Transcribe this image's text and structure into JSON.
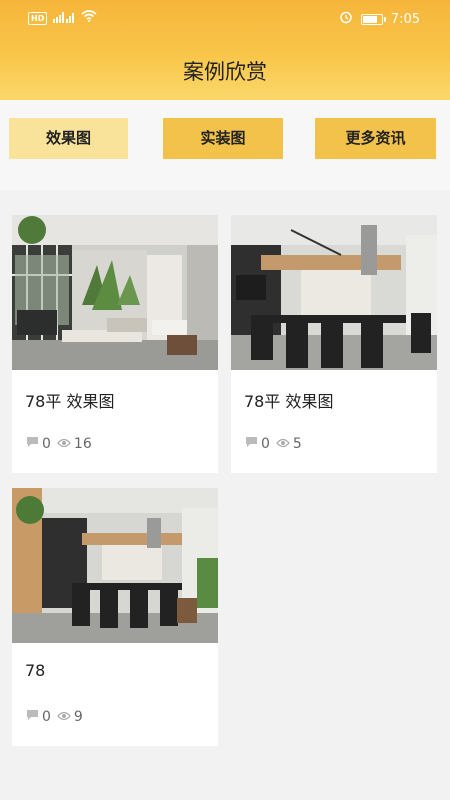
{
  "status_bar": {
    "network": "HD",
    "signal": "4G",
    "time": "7:05"
  },
  "header": {
    "title": "案例欣赏"
  },
  "tabs": [
    {
      "label": "效果图",
      "selected": true
    },
    {
      "label": "实装图",
      "selected": false
    },
    {
      "label": "更多资讯",
      "selected": false
    }
  ],
  "cases": [
    {
      "title": "78平 效果图",
      "comments": "0",
      "views": "16",
      "image": "living-room-photo"
    },
    {
      "title": "78平 效果图",
      "comments": "0",
      "views": "5",
      "image": "dining-kitchen-photo"
    },
    {
      "title": "78",
      "comments": "0",
      "views": "9",
      "image": "dining-kitchen-photo"
    }
  ],
  "colors": {
    "header_gradient_start": "#f6b53a",
    "tab_active": "#f9e29a",
    "tab_inactive": "#f3c24a"
  }
}
